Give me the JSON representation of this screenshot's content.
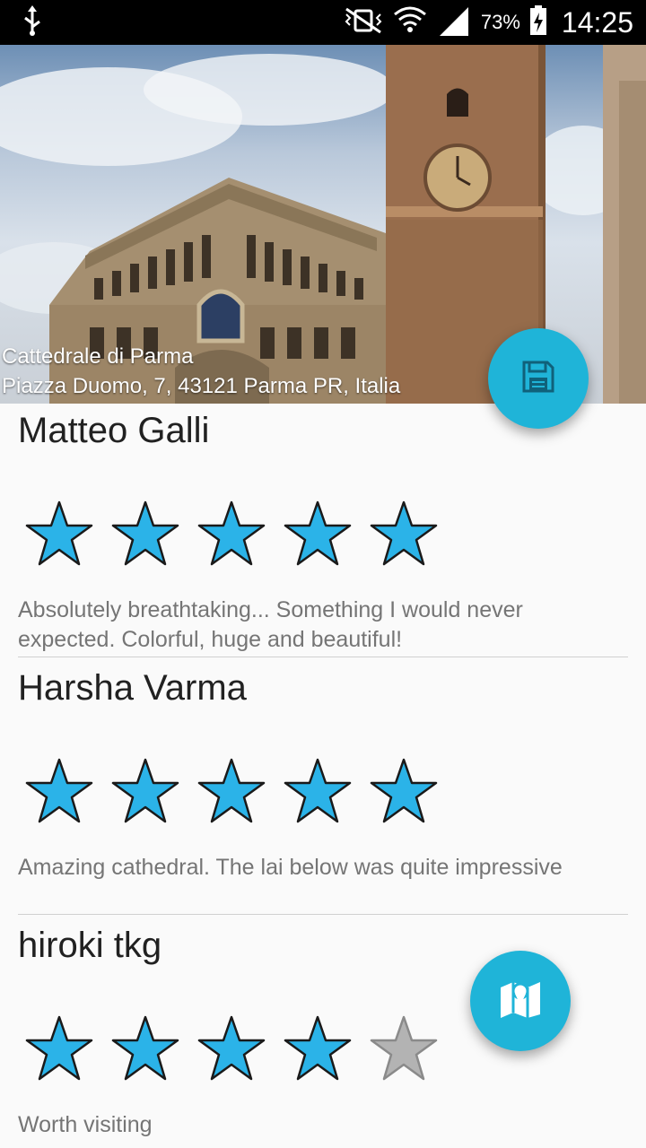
{
  "status_bar": {
    "battery_percent": "73%",
    "time": "14:25"
  },
  "place": {
    "name": "Cattedrale di Parma",
    "address": "Piazza Duomo, 7, 43121 Parma PR, Italia"
  },
  "actions": {
    "save_icon": "floppy-disk-icon",
    "map_icon": "map-icon"
  },
  "reviews": [
    {
      "author": "Matteo Galli",
      "rating": 5,
      "rating_max": 5,
      "text": "Absolutely breathtaking... Something I would never expected. Colorful, huge and beautiful!"
    },
    {
      "author": "Harsha Varma",
      "rating": 5,
      "rating_max": 5,
      "text": "Amazing cathedral. The lai below was quite impressive"
    },
    {
      "author": "hiroki tkg",
      "rating": 4,
      "rating_max": 5,
      "text": "Worth visiting"
    }
  ],
  "colors": {
    "accent": "#1fb4d8",
    "star_filled": "#2bb3e8",
    "star_empty": "#b3b3b3"
  }
}
